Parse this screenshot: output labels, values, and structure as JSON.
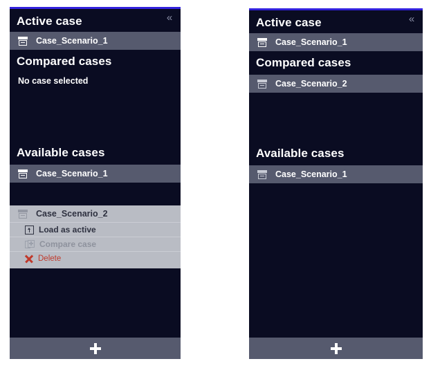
{
  "theme": {
    "panel_background": "#0a0c22",
    "accent_bar": "#3322dd",
    "row_selected": "#565a6e",
    "context_menu_background": "#b9bcc4",
    "text_primary": "#ffffff",
    "danger": "#c0392b",
    "disabled_text": "#8e929d"
  },
  "panels": {
    "left": {
      "collapse_label": "«",
      "sections": {
        "active": {
          "title": "Active case",
          "rows": [
            {
              "label": "Case_Scenario_1",
              "icon": "archive-box-icon"
            }
          ]
        },
        "compared": {
          "title": "Compared cases",
          "empty_text": "No case selected",
          "rows": []
        },
        "available": {
          "title": "Available cases",
          "rows": [
            {
              "label": "Case_Scenario_1",
              "icon": "archive-box-icon"
            },
            {
              "label": "Case_Scenario_2",
              "icon": "archive-box-icon"
            }
          ]
        }
      },
      "context_menu": {
        "target_label": "Case_Scenario_2",
        "items": [
          {
            "label": "Load as active",
            "icon": "load-as-active-icon",
            "state": "enabled"
          },
          {
            "label": "Compare case",
            "icon": "compare-case-icon",
            "state": "disabled"
          },
          {
            "label": "Delete",
            "icon": "delete-x-icon",
            "state": "danger"
          }
        ]
      },
      "footer": {
        "add_label": "+",
        "icon": "plus-icon"
      }
    },
    "right": {
      "collapse_label": "«",
      "sections": {
        "active": {
          "title": "Active case",
          "rows": [
            {
              "label": "Case_Scenario_1",
              "icon": "archive-box-icon"
            }
          ]
        },
        "compared": {
          "title": "Compared cases",
          "rows": [
            {
              "label": "Case_Scenario_2",
              "icon": "archive-box-icon"
            }
          ]
        },
        "available": {
          "title": "Available cases",
          "rows": [
            {
              "label": "Case_Scenario_1",
              "icon": "archive-box-icon"
            }
          ]
        }
      },
      "footer": {
        "add_label": "+",
        "icon": "plus-icon"
      }
    }
  }
}
